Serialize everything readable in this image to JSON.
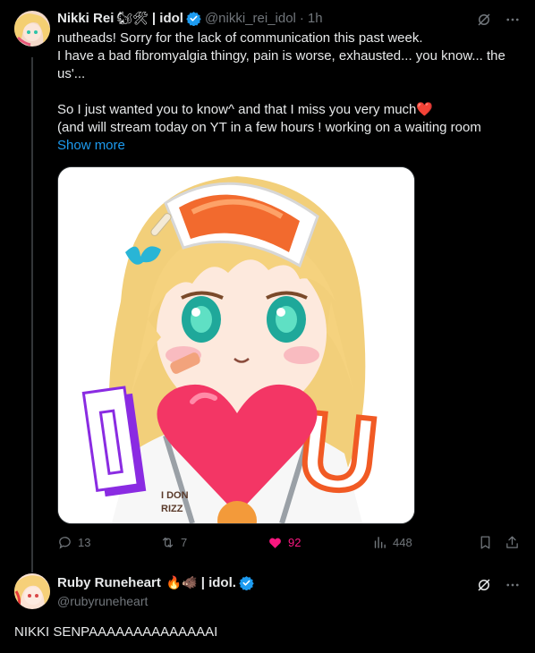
{
  "post": {
    "display_name": "Nikki Rei",
    "name_emojis": "🐿🛠",
    "name_suffix": "| idol",
    "handle": "@nikki_rei_idol",
    "separator": "·",
    "time": "1h",
    "body_lines": [
      "nutheads! Sorry for the lack of communication this past week.",
      "I have a bad fibromyalgia thingy, pain is worse, exhausted... you know... the us'...",
      "",
      "So I just wanted you to know^ and that I miss you very much❤️",
      "(and will stream today on YT in a few hours ! working on a waiting room"
    ],
    "show_more_label": "Show more",
    "image": {
      "big_letter_left": "I",
      "big_letter_right": "U",
      "shirt_text_1": "I DON",
      "shirt_text_2": "RIZZ"
    },
    "stats": {
      "replies": "13",
      "reposts": "7",
      "likes": "92",
      "views": "448"
    }
  },
  "reply": {
    "display_name": "Ruby Runeheart",
    "name_emojis": "🔥🐗",
    "name_suffix": "| idol.",
    "handle": "@rubyruneheart",
    "text": "NIKKI SENPAAAAAAAAAAAAAAI"
  },
  "colors": {
    "accent": "#1d9bf0",
    "like": "#f91880",
    "muted": "#71767b",
    "text": "#e7e9ea"
  }
}
